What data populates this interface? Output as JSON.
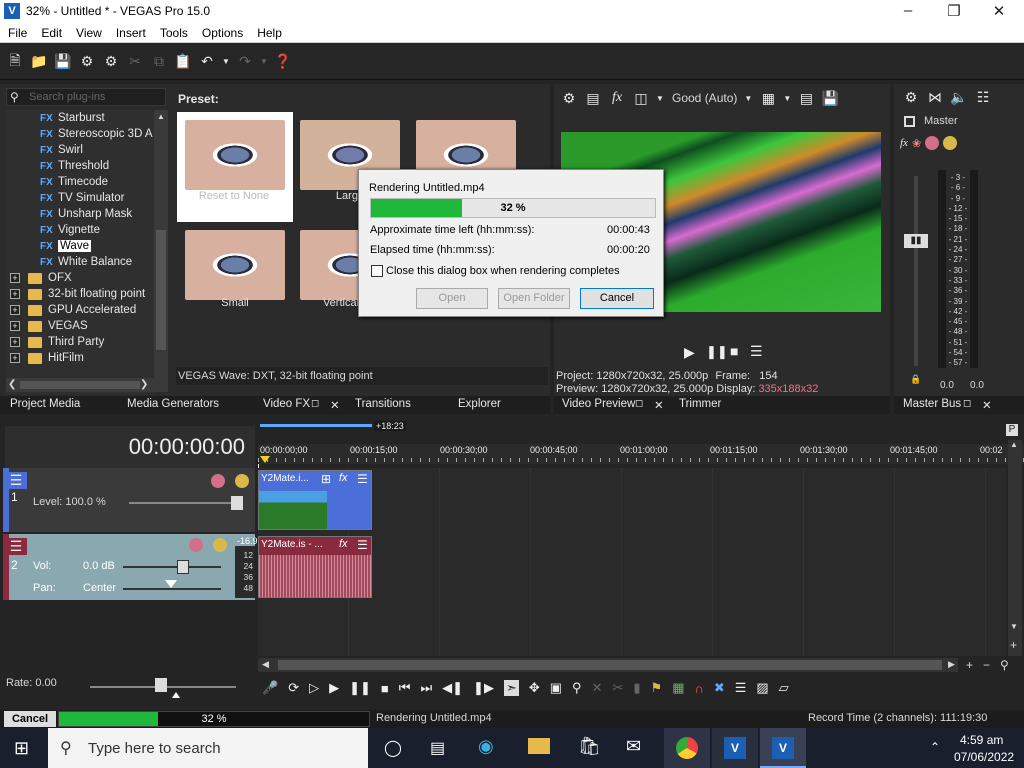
{
  "window": {
    "app_title": "32% - Untitled * - VEGAS Pro 15.0",
    "app_icon_letter": "V"
  },
  "menu": [
    "File",
    "Edit",
    "View",
    "Insert",
    "Tools",
    "Options",
    "Help"
  ],
  "plugins": {
    "search_placeholder": "Search plug-ins",
    "preset_label": "Preset:",
    "fx_items": [
      "Starburst",
      "Stereoscopic 3D A",
      "Swirl",
      "Threshold",
      "Timecode",
      "TV Simulator",
      "Unsharp Mask",
      "Vignette",
      "Wave",
      "White Balance"
    ],
    "fx_tag": "FX",
    "selected_item": "Wave",
    "folders": [
      "OFX",
      "32-bit floating point",
      "GPU Accelerated",
      "VEGAS",
      "Third Party",
      "HitFilm"
    ],
    "presets": [
      "Reset to None",
      "Large",
      "Small",
      "Vertical"
    ],
    "status": "VEGAS Wave: DXT, 32-bit floating point"
  },
  "dock_tabs": {
    "left": [
      "Project Media",
      "Media Generators",
      "Video FX",
      "Transitions",
      "Explorer"
    ],
    "preview": [
      "Video Preview",
      "Trimmer"
    ],
    "master": [
      "Master Bus"
    ]
  },
  "preview": {
    "quality": "Good (Auto)",
    "project_label": "Project:",
    "project_value": "1280x720x32, 25.000p",
    "frame_label": "Frame:",
    "frame_value": "154",
    "preview_label": "Preview:",
    "preview_value": "1280x720x32, 25.000p",
    "display_label": "Display:",
    "display_value": "335x188x32"
  },
  "master": {
    "label": "Master",
    "scale": [
      "- 3 -",
      "- 6 -",
      "- 9 -",
      "- 12 -",
      "- 15 -",
      "- 18 -",
      "- 21 -",
      "- 24 -",
      "- 27 -",
      "- 30 -",
      "- 33 -",
      "- 36 -",
      "- 39 -",
      "- 42 -",
      "- 45 -",
      "- 48 -",
      "- 51 -",
      "- 54 -",
      "- 57 -"
    ],
    "left_value": "0.0",
    "right_value": "0.0"
  },
  "timeline": {
    "timecode": "00:00:00:00",
    "loop_marker": "+18:23",
    "ruler": [
      "00:00:00;00",
      "00:00:15;00",
      "00:00:30;00",
      "00:00:45;00",
      "00:01:00;00",
      "00:01:15;00",
      "00:01:30;00",
      "00:01:45;00",
      "00:02"
    ],
    "video_track": {
      "number": "1",
      "level": "Level: 100.0 %",
      "clip_name": "Y2Mate.i..."
    },
    "audio_track": {
      "number": "2",
      "vol_label": "Vol:",
      "vol_value": "0.0 dB",
      "pan_label": "Pan:",
      "pan_value": "Center",
      "clip_name": "Y2Mate.is - ...",
      "peak": "-16.9",
      "meter_scale": [
        "12",
        "24",
        "36",
        "48"
      ]
    },
    "rate": "Rate: 0.00"
  },
  "render_bar": {
    "cancel": "Cancel",
    "percent": "32 %",
    "progress": 0.32,
    "message": "Rendering Untitled.mp4",
    "record_time": "Record Time (2 channels): 111:19:30"
  },
  "dialog": {
    "title": "Rendering Untitled.mp4",
    "percent": "32 %",
    "progress": 0.32,
    "time_left_label": "Approximate time left (hh:mm:ss):",
    "time_left_value": "00:00:43",
    "elapsed_label": "Elapsed time (hh:mm:ss):",
    "elapsed_value": "00:00:20",
    "checkbox_label": "Close this dialog box when rendering completes",
    "open_button": "Open",
    "open_folder_button": "Open Folder",
    "cancel_button": "Cancel"
  },
  "taskbar": {
    "search_placeholder": "Type here to search",
    "time": "4:59 am",
    "date": "07/06/2022"
  },
  "colors": {
    "accent_blue": "#4b6ed8",
    "audio_red": "#8a2a3e",
    "progress_green": "#1fb83a",
    "preview_green": "#3cc63c"
  }
}
